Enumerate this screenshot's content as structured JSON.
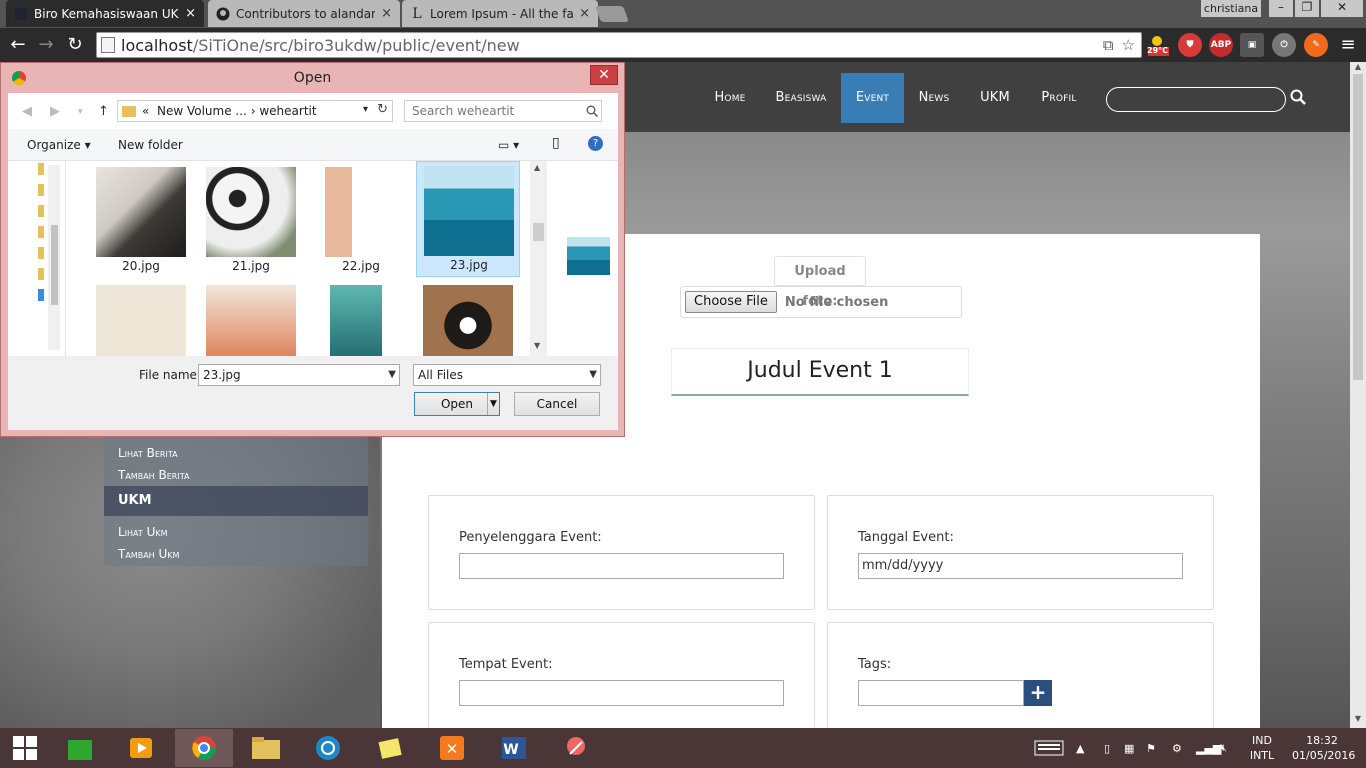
{
  "browser": {
    "tabs": [
      {
        "title": "Biro Kemahasiswaan UKD",
        "active": true
      },
      {
        "title": "Contributors to alandarm",
        "active": false
      },
      {
        "title": "Lorem Ipsum - All the fact",
        "active": false
      }
    ],
    "tab_close": "×",
    "user": "christiana",
    "url_host": "localhost",
    "url_path": "/SiTiOne/src/biro3ukdw/public/event/new",
    "weather_temp": "29°C",
    "abp_label": "ABP"
  },
  "site": {
    "nav": [
      "Home",
      "Beasiswa",
      "Event",
      "News",
      "UKM",
      "Profil"
    ],
    "nav_active": "Event",
    "sidebar": {
      "berita_links": [
        "Lihat Berita",
        "Tambah Berita"
      ],
      "ukm_heading": "UKM",
      "ukm_links": [
        "Lihat Ukm",
        "Tambah Ukm"
      ]
    },
    "form": {
      "upload_label": "Upload foto:",
      "choose_file": "Choose File",
      "no_file": "No file chosen",
      "event_title": "Judul Event 1",
      "penyelenggara_label": "Penyelenggara Event:",
      "tanggal_label": "Tanggal Event:",
      "tanggal_placeholder": "mm/dd/yyyy",
      "tempat_label": "Tempat Event:",
      "tags_label": "Tags:",
      "tags_add": "+"
    }
  },
  "dialog": {
    "title": "Open",
    "breadcrumb": [
      "«",
      "New Volume ...",
      "›",
      "weheartit"
    ],
    "search_placeholder": "Search weheartit",
    "organize": "Organize ▾",
    "new_folder": "New folder",
    "files": [
      {
        "name": "20.jpg",
        "selected": false
      },
      {
        "name": "21.jpg",
        "selected": false
      },
      {
        "name": "22.jpg",
        "selected": false
      },
      {
        "name": "23.jpg",
        "selected": true
      }
    ],
    "file_name_label": "File name:",
    "file_name_value": "23.jpg",
    "file_type": "All Files",
    "open_button": "Open",
    "cancel_button": "Cancel"
  },
  "taskbar": {
    "lang_top": "IND",
    "lang_bottom": "INTL",
    "time": "18:32",
    "date": "01/05/2016"
  },
  "colors": {
    "nav_active": "#3a7db5",
    "tags_button": "#2b4f7c",
    "dialog_frame": "#e8b4b4",
    "taskbar": "#4a3636"
  }
}
